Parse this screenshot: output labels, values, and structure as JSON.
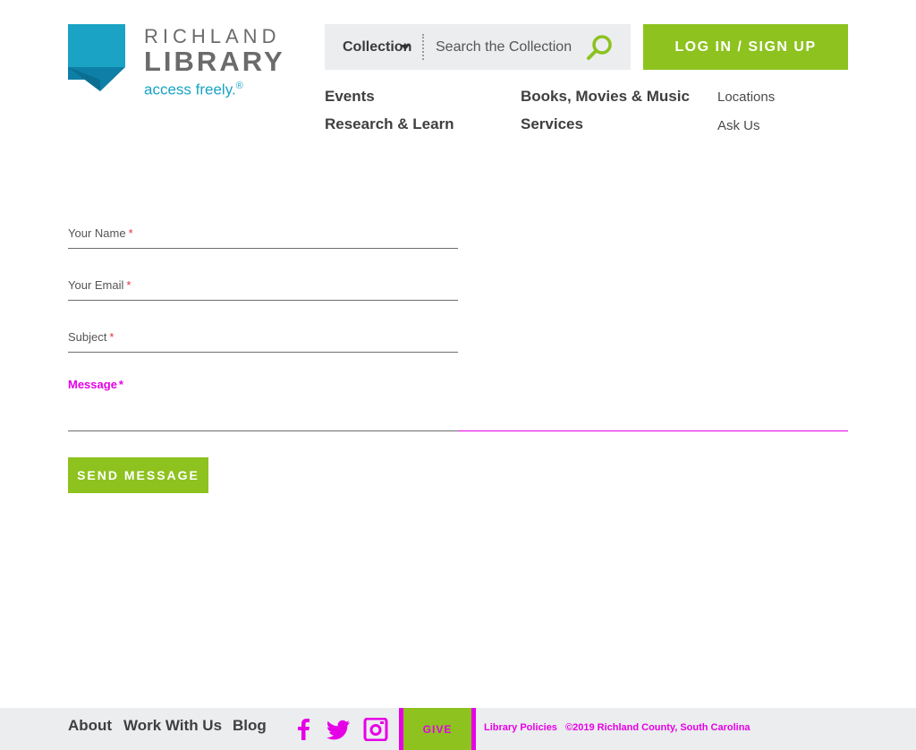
{
  "brand": {
    "line1": "RICHLAND",
    "line2": "LIBRARY",
    "tagline": "access freely.",
    "tagline_mark": "®",
    "colors": {
      "blue": "#1aa3c4",
      "dark_blue": "#0e7fa6",
      "green": "#8dc21f",
      "magenta": "#e600e6"
    }
  },
  "search": {
    "scope": "Collection",
    "placeholder": "Search the Collection",
    "icon": "search-icon"
  },
  "login": {
    "label": "LOG IN / SIGN UP"
  },
  "nav": {
    "events": "Events",
    "research": "Research & Learn",
    "books": "Books, Movies & Music",
    "services": "Services",
    "locations": "Locations",
    "ask": "Ask Us"
  },
  "form": {
    "name_label": "Your Name",
    "email_label": "Your Email",
    "subject_label": "Subject",
    "message_label": "Message",
    "required_mark": "*",
    "send_label": "SEND MESSAGE"
  },
  "footer": {
    "about": "About",
    "work": "Work With Us",
    "blog": "Blog",
    "social": [
      "facebook-icon",
      "twitter-icon",
      "instagram-icon"
    ],
    "give": "GIVE",
    "policies": "Library Policies",
    "copyright": "©2019 Richland County, South Carolina"
  }
}
